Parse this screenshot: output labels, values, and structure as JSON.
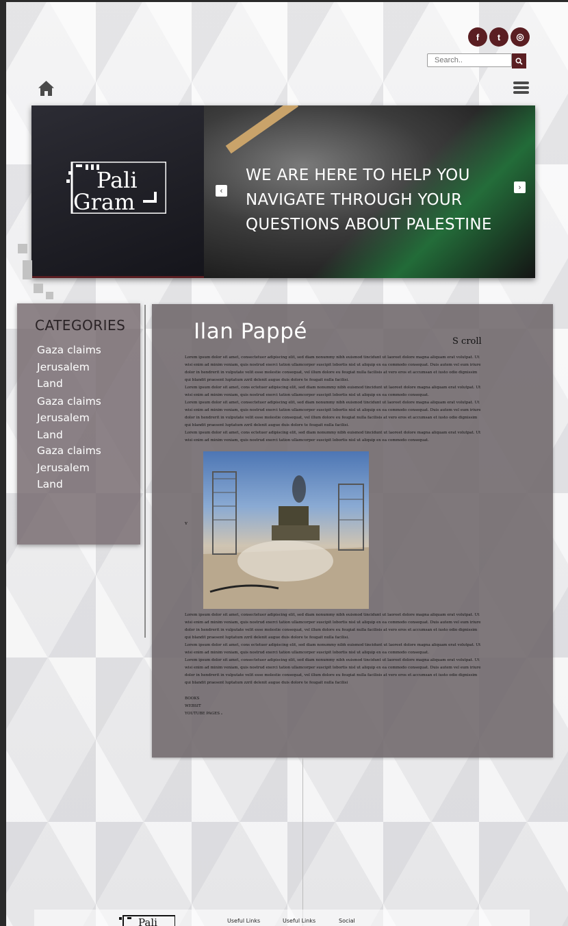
{
  "header": {
    "social": [
      {
        "name": "facebook-icon",
        "glyph": "f"
      },
      {
        "name": "twitter-icon",
        "glyph": "t"
      },
      {
        "name": "instagram-icon",
        "glyph": "◎"
      }
    ],
    "search_placeholder": "Search..",
    "accent_color": "#5a1e22"
  },
  "hero": {
    "logo_line1": "Pali",
    "logo_line2": "Gram",
    "lines": [
      "WE ARE HERE TO HELP YOU",
      "NAVIGATE THROUGH YOUR",
      "QUESTIONS ABOUT PALESTINE"
    ],
    "prev": "‹",
    "next": "›"
  },
  "categories": {
    "title": "CATEGORIES",
    "items": [
      "Gaza claims",
      "Jerusalem",
      "Land",
      "Gaza claims",
      "Jerusalem",
      "Land",
      "Gaza claims",
      "Jerusalem",
      "Land"
    ]
  },
  "article": {
    "title": "Ilan Pappé",
    "scroll": "S croll",
    "p1": "Lorem ipsum dolor sit amet, consectetuer adipiscing elit, sed diam nonummy nibh euismod tincidunt ut laoreet dolore magna aliquam erat volutpat. Ut wisi enim ad minim veniam, quis nostrud exerci tation ullamcorper suscipit lobortis nisl ut aliquip ex ea commodo consequat. Duis autem vel eum iriure dolor in hendrerit in vulputate velit esse molestie consequat, vel illum dolore eu feugiat nulla facilisis at vero eros et accumsan et iusto odio dignissim qui blandit praesent luptatum zzril delenit augue duis dolore te feugait nulla facilisi.",
    "p2": "Lorem ipsum dolor sit amet, cons ectetuer adipiscing elit, sed diam nonummy nibh euismod tincidunt ut laoreet dolore magna aliquam erat volutpat. Ut wisi enim ad minim veniam, quis nostrud exerci tation ullamcorper suscipit lobortis nisl ut aliquip ex ea commodo consequat.",
    "p3": "Lorem ipsum dolor sit amet, consectetuer adipiscing elit, sed diam nonummy nibh euismod tincidunt ut laoreet dolore magna aliquam erat volutpat. Ut wisi enim ad minim veniam, quis nostrud exerci tation ullamcorper suscipit lobortis nisl ut aliquip ex ea commodo consequat. Duis autem vel eum iriure dolor in hendrerit in vulputate velit esse molestie consequat, vel illum dolore eu feugiat nulla facilisis at vero eros et accumsan et iusto odio dignissim qui blandit praesent luptatum zzril delenit augue duis dolore te feugait nulla facilisi.",
    "p4": "Lorem ipsum dolor sit amet, cons ectetuer adipiscing elit, sed diam nonummy nibh euismod tincidunt ut laoreet dolore magna aliquam erat volutpat. Ut wisi enim ad minim veniam, quis nostrud exerci tation ullamcorper suscipit lobortis nisl ut aliquip ex ea commodo consequat.",
    "v": "v",
    "p5": "Lorem ipsum dolor sit amet, consectetuer adipiscing elit, sed diam nonummy nibh euismod tincidunt ut laoreet dolore magna aliquam erat volutpat. Ut wisi enim ad minim veniam, quis nostrud exerci tation ullamcorper suscipit lobortis nisl ut aliquip ex ea commodo consequat. Duis autem vel eum iriure dolor in hendrerit in vulputate velit esse molestie consequat, vel illum dolore eu feugiat nulla facilisis at vero eros et accumsan et iusto odio dignissim qui blandit praesent luptatum zzril delenit augue duis dolore te feugait nulla facilisi.",
    "p6": "Lorem ipsum dolor sit amet, cons ectetuer adipiscing elit, sed diam nonummy nibh euismod tincidunt ut laoreet dolore magna aliquam erat volutpat. Ut wisi enim ad minim veniam, quis nostrud exerci tation ullamcorper suscipit lobortis nisl ut aliquip ex ea commodo consequat.",
    "p7": "Lorem ipsum dolor sit amet, consectetuer adipiscing elit, sed diam nonummy nibh euismod tincidunt ut laoreet dolore magna aliquam erat volutpat. Ut wisi enim ad minim veniam, quis nostrud exerci tation ullamcorper suscipit lobortis nisl ut aliquip ex ea commodo consequat. Duis autem vel eum iriure dolor in hendrerit in vulputate velit esse molestie consequat, vel illum dolore eu feugiat nulla facilisis at vero eros et accumsan et iusto odio dignissim qui blandit praesent luptatum zzril delenit augue duis dolore te feugait nulla facilisi",
    "links": [
      "BOOKS",
      "WEBSIT",
      "YOUTUBE PAGES ₑ"
    ]
  },
  "footer": {
    "col1": "Useful Links",
    "col2": "Useful Links",
    "col3": "Social"
  }
}
